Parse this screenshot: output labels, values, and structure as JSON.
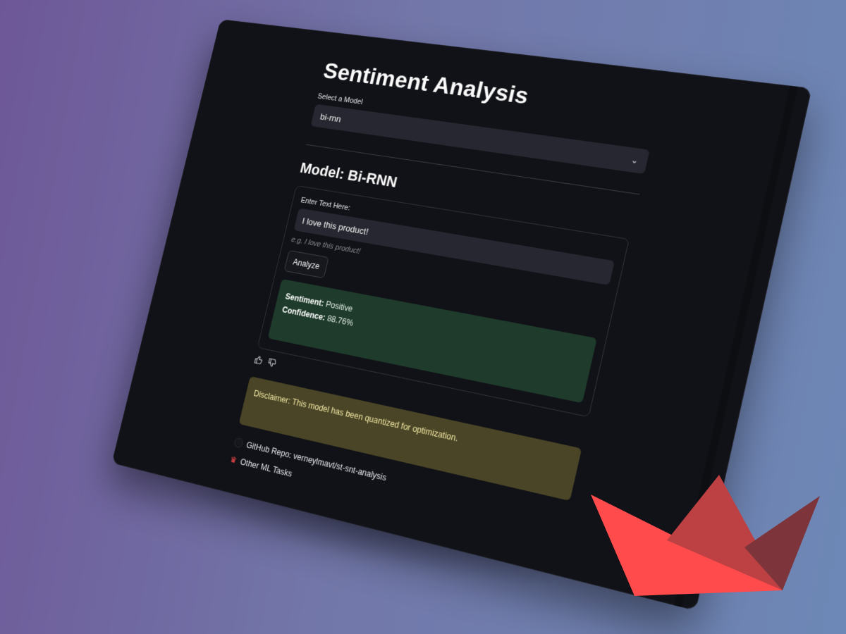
{
  "app": {
    "title": "Sentiment Analysis"
  },
  "model_select": {
    "label": "Select a Model",
    "value": "bi-rnn"
  },
  "model_heading": "Model: Bi-RNN",
  "form": {
    "input_label": "Enter Text Here:",
    "input_value": "I love this product!",
    "hint": "e.g. I love this product!",
    "button_label": "Analyze"
  },
  "result": {
    "sentiment_label": "Sentiment:",
    "sentiment_value": "Positive",
    "confidence_label": "Confidence:",
    "confidence_value": "88.76%"
  },
  "disclaimer": "Disclaimer: This model has been quantized for optimization.",
  "links": {
    "github": "GitHub Repo: verneylmavt/st-snt-analysis",
    "other": "Other ML Tasks"
  },
  "icons": {
    "dropdown": "chevron-down-icon",
    "thumbs_up": "thumbs-up-icon",
    "thumbs_down": "thumbs-down-icon",
    "github": "github-icon",
    "crown": "crown-icon",
    "logo": "streamlit-boat-logo"
  },
  "colors": {
    "background_start": "#6e5797",
    "background_end": "#6d88b6",
    "screen": "#111217",
    "input": "#262730",
    "success": "#1e3b2b",
    "warning": "#4a4526",
    "brand_red": "#ff4b4b"
  }
}
